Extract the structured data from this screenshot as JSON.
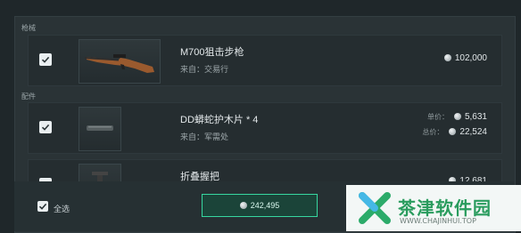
{
  "sections": {
    "firearms_label": "枪械",
    "attachments_label": "配件"
  },
  "items": [
    {
      "name": "M700狙击步枪",
      "source": "来自：交易行",
      "price": "102,000"
    },
    {
      "name": "DD蟒蛇护木片 * 4",
      "source": "来自：军需处",
      "unit_label": "单价：",
      "unit_price": "5,631",
      "total_label": "总价：",
      "total_price": "22,524"
    },
    {
      "name": "折叠握把",
      "price": "12,681"
    }
  ],
  "footer": {
    "select_all_label": "全选",
    "grand_total": "242,495"
  },
  "watermark": {
    "title": "茶津软件园",
    "url": "WWW.CHAJINHUI.TOP"
  },
  "colors": {
    "accent": "#37d7a0",
    "checkbox": "#e9eef0",
    "watermark_green": "#2a9c5e"
  }
}
